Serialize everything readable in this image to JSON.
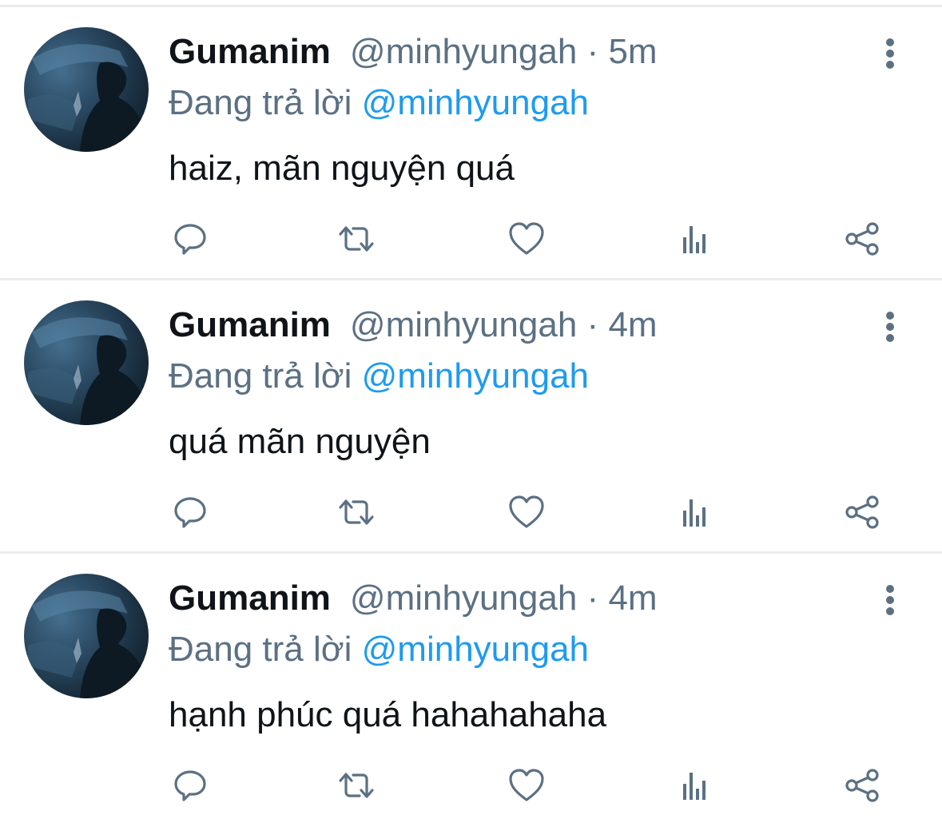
{
  "tweets": [
    {
      "name": "Gumanim",
      "handle": "@minhyungah",
      "separator": "·",
      "time": "5m",
      "reply_prefix": "Đang trả lời",
      "reply_to": "@minhyungah",
      "text": "haiz, mãn nguyện quá"
    },
    {
      "name": "Gumanim",
      "handle": "@minhyungah",
      "separator": "·",
      "time": "4m",
      "reply_prefix": "Đang trả lời",
      "reply_to": "@minhyungah",
      "text": "quá mãn nguyện"
    },
    {
      "name": "Gumanim",
      "handle": "@minhyungah",
      "separator": "·",
      "time": "4m",
      "reply_prefix": "Đang trả lời",
      "reply_to": "@minhyungah",
      "text": "hạnh phúc quá hahahahaha"
    }
  ],
  "icons": {
    "more": "more-vertical-icon",
    "reply": "reply-icon",
    "retweet": "retweet-icon",
    "like": "heart-icon",
    "stats": "stats-icon",
    "share": "share-icon"
  },
  "colors": {
    "text": "#0f1419",
    "secondary": "#5b7083",
    "mention": "#1d9bf0",
    "divider": "#e9eced"
  }
}
